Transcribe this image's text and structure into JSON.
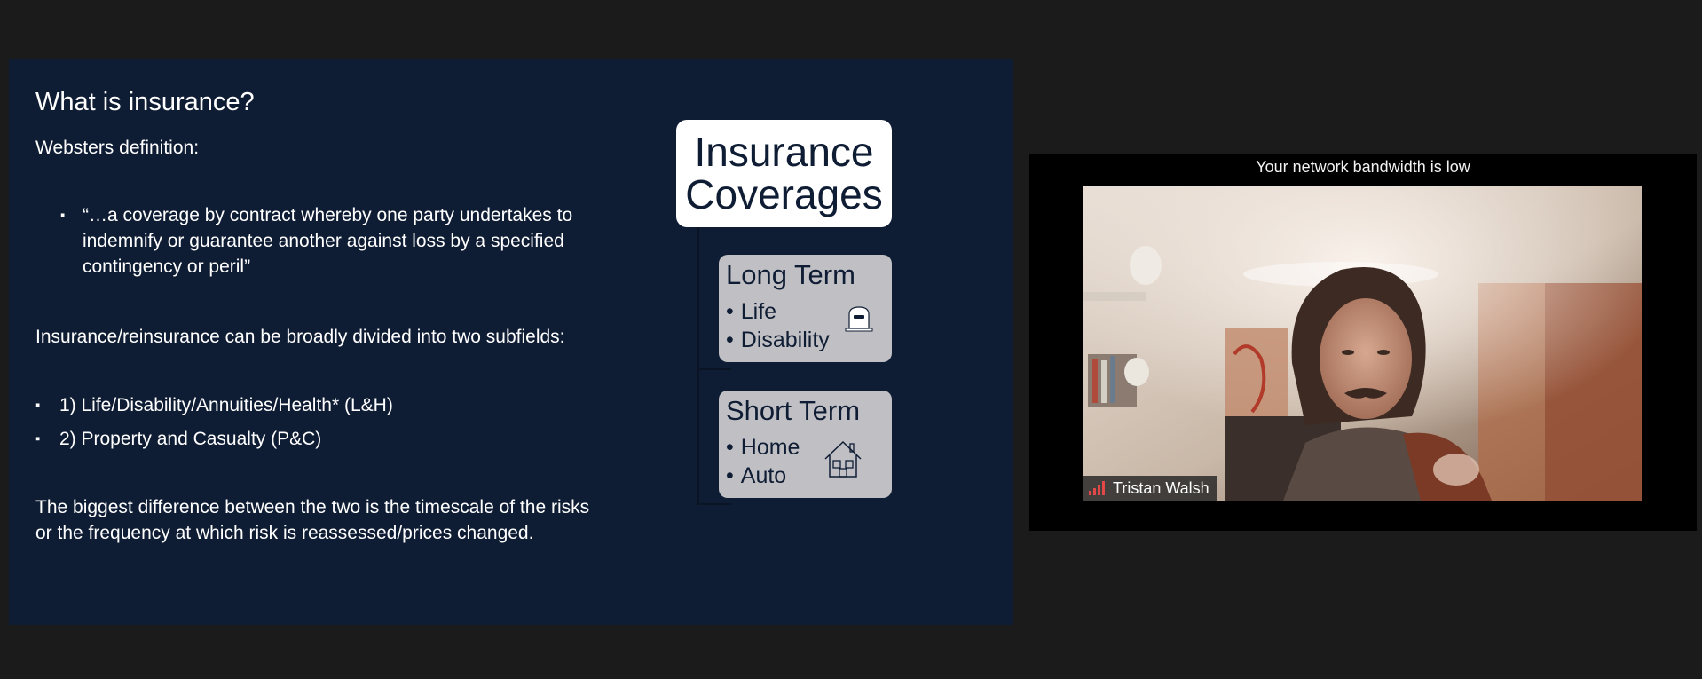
{
  "slide": {
    "title": "What is insurance?",
    "definition_heading": "Websters definition:",
    "quote_lines": [
      "“…a coverage by contract whereby one party undertakes to",
      "indemnify or guarantee another against loss by a specified",
      "contingency or peril”"
    ],
    "subfields_intro": "Insurance/reinsurance can be broadly divided into two subfields:",
    "subfields": [
      "1) Life/Disability/Annuities/Health* (L&H)",
      "2) Property and Casualty (P&C)"
    ],
    "conclusion_lines": [
      "The biggest difference between the two is the timescale of the risks",
      "or the frequency at which risk is reassessed/prices changed."
    ],
    "bullet_glyph": "▪",
    "diagram": {
      "header_lines": [
        "Insurance",
        "Coverages"
      ],
      "long_term": {
        "title": "Long Term",
        "items": [
          "Life",
          "Disability"
        ],
        "icon": "tombstone-icon"
      },
      "short_term": {
        "title": "Short Term",
        "items": [
          "Home",
          "Auto"
        ],
        "icon": "house-icon"
      }
    }
  },
  "video": {
    "warning": "Your network bandwidth is low",
    "participant_name": "Tristan Walsh",
    "signal_icon": "signal-strength-icon",
    "signal_color": "#e34848"
  },
  "colors": {
    "slide_background": "#0f1d34",
    "app_background": "#1b1b1b",
    "term_box_fill": "#c0c0c4"
  }
}
